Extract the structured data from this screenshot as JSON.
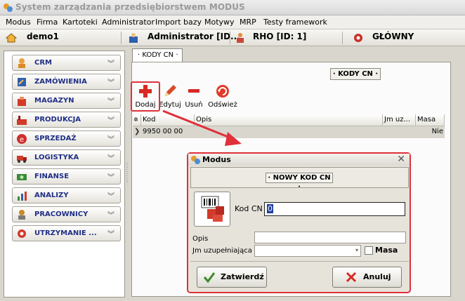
{
  "window": {
    "title": "System zarządzania przedsiębiorstwem MODUS"
  },
  "menu": [
    "Modus",
    "Firma",
    "Kartoteki",
    "Administrator",
    "Import bazy",
    "Motywy",
    "MRP",
    "Testy framework"
  ],
  "status": {
    "company": "demo1",
    "user": "Administrator [ID...",
    "role": "RHO [ID: 1]",
    "module": "GŁÓWNY"
  },
  "sidebar": {
    "items": [
      {
        "label": "CRM",
        "color": "#e8a33a"
      },
      {
        "label": "ZAMÓWIENIA",
        "color": "#2f5fb0"
      },
      {
        "label": "MAGAZYN",
        "color": "#d23a2a"
      },
      {
        "label": "PRODUKCJA",
        "color": "#d23a2a"
      },
      {
        "label": "SPRZEDAŻ",
        "color": "#cf2e2e"
      },
      {
        "label": "LOGISTYKA",
        "color": "#d23a2a"
      },
      {
        "label": "FINANSE",
        "color": "#3b8a3b"
      },
      {
        "label": "ANALIZY",
        "color": "#3b8a3b"
      },
      {
        "label": "PRACOWNICY",
        "color": "#c98b2a"
      },
      {
        "label": "UTRZYMANIE ...",
        "color": "#d23a2a"
      }
    ]
  },
  "tab": {
    "label": "· KODY CN ·"
  },
  "panel": {
    "caption": "· KODY CN ·"
  },
  "toolbar": {
    "add": "Dodaj",
    "edit": "Edytuj",
    "delete": "Usuń",
    "refresh": "Odśwież"
  },
  "grid": {
    "columns": [
      "Kod",
      "Opis",
      "Jm uz...",
      "Masa"
    ],
    "rows": [
      {
        "kod": "9950 00 00",
        "opis": "",
        "jm": "",
        "masa": "Nie"
      }
    ]
  },
  "dialog": {
    "title": "Modus",
    "caption": "· NOWY KOD CN ·",
    "kod_label": "Kod CN",
    "kod_value": "0",
    "opis_label": "Opis",
    "opis_value": "",
    "jm_label": "Jm uzupełniająca",
    "jm_value": "",
    "masa_label": "Masa",
    "ok_label": "Zatwierdź",
    "cancel_label": "Anuluj"
  },
  "colors": {
    "highlight": "#e0303a",
    "accent_text": "#1f2f86"
  }
}
